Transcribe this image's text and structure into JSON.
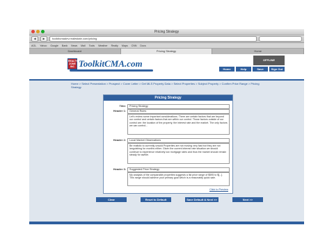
{
  "window": {
    "title": "Pricing Strategy"
  },
  "browser": {
    "url": "toolkitcmadev.realestate.com/pricing",
    "bookmarks": [
      "AOL",
      "Yahoo",
      "Google",
      "Bank",
      "News",
      "Mail",
      "Tools",
      "Weather",
      "Realty",
      "Maps",
      "CNN",
      "Docs"
    ],
    "tabs": [
      "Dashboard",
      "Pricing Strategy",
      "Home"
    ]
  },
  "site": {
    "badge": "REALTY ZONE INC",
    "logo": "ToolkitCMA.com",
    "support_label": "OFFLINE",
    "nav": [
      "Home",
      "Help",
      "Save",
      "Sign Out"
    ]
  },
  "breadcrumb": "Home > Select Presentation > Prospect > Cover Letter > Get MLS Property Data > Select Properties > Subject Property > Confirm Price Range > Pricing Strategy",
  "panel": {
    "title": "Pricing Strategy",
    "title_label": "Title:",
    "title_value": "Pricing Strategy",
    "header1_label": "Header 1:",
    "header1_value": "General Rules",
    "body1": "Let's review some important considerations. There are certain factors that are beyond our control and certain factors that are within our control. Those factors outside of our control are: the location of the property, the interest rate and the market. The only factors we can control...",
    "header2_label": "Header 2:",
    "header2_value": "Local Market Observations",
    "body2": "Be realistic to currently unsold Properties are not moving very fast but they are not languishing for months either. Given the current interest rate situation we should continue to experience relatively low mortgage rates and thus the market should remain steady for awhile.",
    "header3_label": "Header 3:",
    "header3_value": "Suggested Price Strategy",
    "body3": "My analysis of the comparable properties suggests a list price range of $595 to $[...]. This range should achieve your primary goal which is a reasonably quick sale.",
    "preview_link": "Click to Preview"
  },
  "actions": [
    "Clear",
    "Reset to Default",
    "Save Default & Next >>",
    "Next >>"
  ]
}
